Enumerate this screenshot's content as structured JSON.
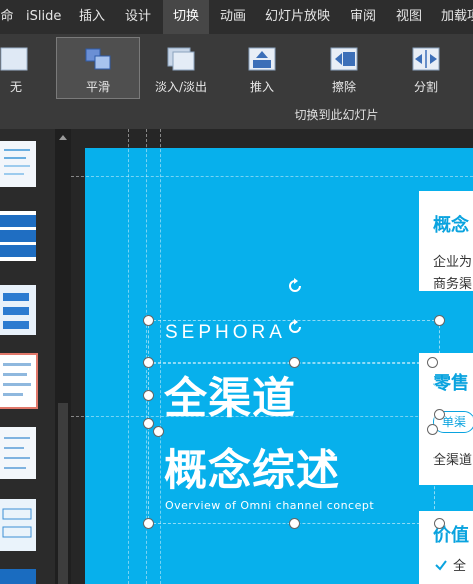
{
  "ribbon": {
    "tabs": [
      "命",
      "iSlide",
      "插入",
      "设计",
      "切换",
      "动画",
      "幻灯片放映",
      "审阅",
      "视图",
      "加载项"
    ],
    "active_tab": "切换",
    "transitions": [
      "无",
      "平滑",
      "淡入/淡出",
      "推入",
      "擦除",
      "分割"
    ],
    "selected_transition": "平滑",
    "group_label": "切换到此幻灯片"
  },
  "slide": {
    "brand": "SEPHORA",
    "title_line1": "全渠道",
    "title_line2": "概念综述",
    "subtitle": "Overview of Omni channel concept",
    "card1": {
      "title": "概念",
      "line1": "企业为",
      "line2": "商务渠"
    },
    "card2": {
      "title": "零售",
      "pill": "单渠",
      "line1": "全渠道"
    },
    "card3": {
      "title": "价值",
      "check_text": "全"
    }
  },
  "colors": {
    "slide_bg": "#07b0ec",
    "accent": "#0aa3df",
    "selected_thumb_border": "#e1786a"
  }
}
